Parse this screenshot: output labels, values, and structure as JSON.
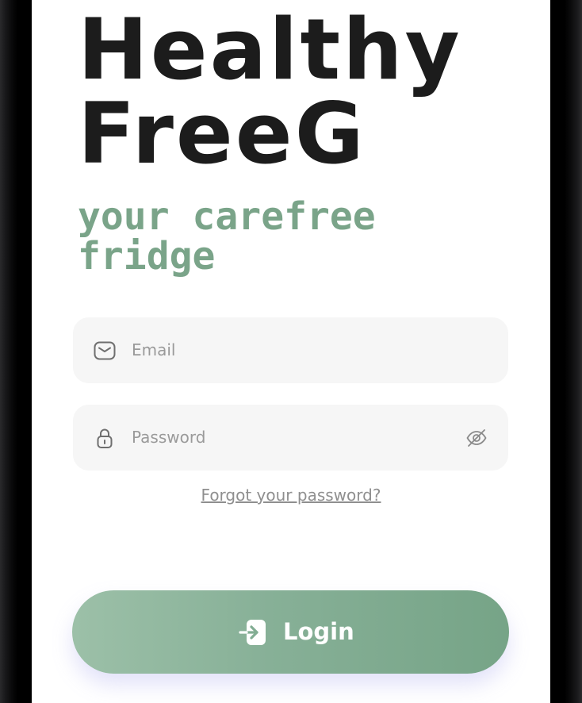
{
  "brand": {
    "title_line1": "Healthy",
    "title_line2": "FreeG",
    "tagline_line1": "your carefree",
    "tagline_line2": "fridge"
  },
  "login_form": {
    "email": {
      "placeholder": "Email",
      "value": "",
      "icon": "mail-icon"
    },
    "password": {
      "placeholder": "Password",
      "value": "",
      "icon": "lock-icon",
      "toggle_icon": "eye-off-icon"
    },
    "forgot_link": "Forgot your password?",
    "login_button": {
      "label": "Login",
      "icon": "login-arrow-icon"
    }
  },
  "colors": {
    "title": "#1c1c1c",
    "tagline": "#7aa489",
    "field_background": "#f6f6f6",
    "button_gradient_start": "#9cc0a8",
    "button_gradient_end": "#76a487",
    "placeholder": "#9a9a9a"
  }
}
